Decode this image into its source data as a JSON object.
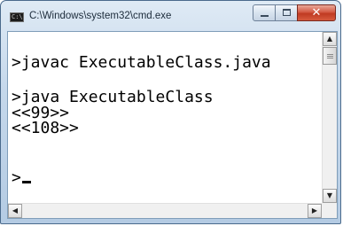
{
  "window": {
    "title": "C:\\Windows\\system32\\cmd.exe",
    "icon_label": "C:\\",
    "controls": {
      "minimize": "minimize-icon",
      "maximize": "maximize-icon",
      "close": "✕"
    }
  },
  "console": {
    "lines": [
      ">javac ExecutableClass.java",
      "",
      ">java ExecutableClass",
      "<<99>>",
      "<<108>>",
      "",
      ">"
    ]
  },
  "scrollbar": {
    "up": "▲",
    "down": "▼",
    "left": "◀",
    "right": "▶"
  },
  "colors": {
    "frame": "#c5d8eb",
    "close_button": "#d45a44",
    "console_bg": "#ffffff",
    "console_text": "#000000"
  }
}
